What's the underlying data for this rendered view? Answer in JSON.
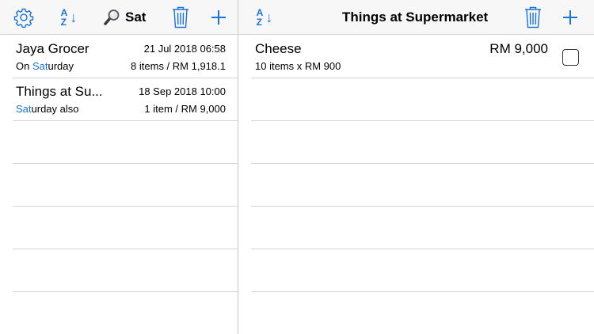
{
  "left": {
    "toolbar": {
      "settings_icon": "gear-icon",
      "sort_top": "A",
      "sort_bottom": "Z",
      "sort_arrow": "↓",
      "search_icon": "magnifier-icon",
      "search_query": "Sat",
      "delete_icon": "trash-icon",
      "add_label": "+"
    },
    "lists": [
      {
        "title": "Jaya Grocer",
        "date": "21 Jul 2018 06:58",
        "note_before": "On ",
        "note_match": "Sat",
        "note_after": "urday",
        "summary": "8 items / RM 1,918.1"
      },
      {
        "title": "Things at Su...",
        "date": "18 Sep 2018 10:00",
        "note_before": "",
        "note_match": "Sat",
        "note_after": "urday also",
        "summary": "1 item / RM 9,000"
      }
    ]
  },
  "right": {
    "toolbar": {
      "sort_top": "A",
      "sort_bottom": "Z",
      "sort_arrow": "↓",
      "title": "Things at Supermarket",
      "delete_icon": "trash-icon",
      "add_label": "+"
    },
    "items": [
      {
        "name": "Cheese",
        "price": "RM 9,000",
        "detail": "10 items x RM 900",
        "checked": false
      }
    ]
  },
  "colors": {
    "accent": "#1a73d9",
    "toolbar_bg": "#f7f7f7",
    "separator": "#d6d6da"
  }
}
